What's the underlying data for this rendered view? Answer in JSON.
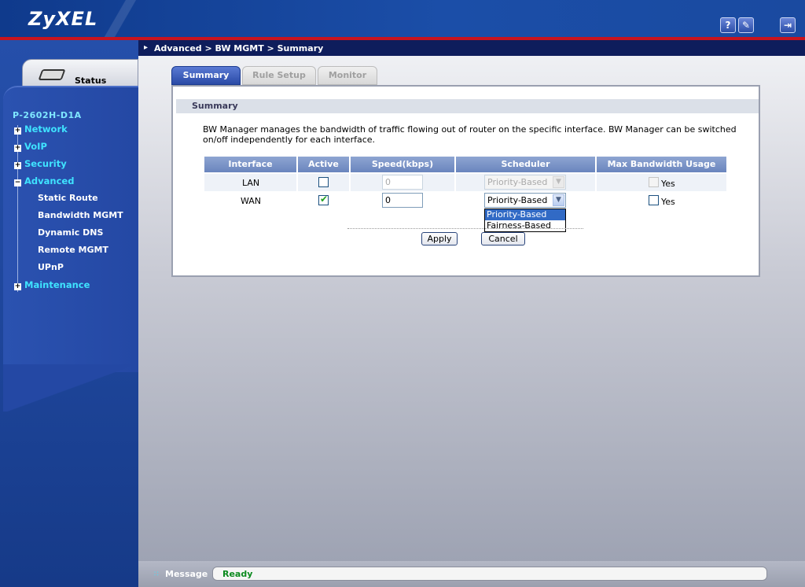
{
  "header": {
    "logo": "ZyXEL",
    "help_label": "?",
    "wizard_label": "✎",
    "logout_label": "⇥"
  },
  "sidebar": {
    "status_label": "Status",
    "model": "P-2602H-D1A",
    "menus": [
      {
        "label": "Network",
        "toggle": "+"
      },
      {
        "label": "VoIP",
        "toggle": "+"
      },
      {
        "label": "Security",
        "toggle": "+"
      },
      {
        "label": "Advanced",
        "toggle": "−"
      },
      {
        "label": "Maintenance",
        "toggle": "+"
      }
    ],
    "advanced_items": [
      "Static Route",
      "Bandwidth MGMT",
      "Dynamic DNS",
      "Remote MGMT",
      "UPnP"
    ]
  },
  "breadcrumb": "Advanced > BW MGMT > Summary",
  "tabs": [
    {
      "label": "Summary",
      "active": true
    },
    {
      "label": "Rule Setup",
      "active": false
    },
    {
      "label": "Monitor",
      "active": false
    }
  ],
  "section_title": "Summary",
  "description": "BW Manager manages the bandwidth of traffic flowing out of router on the specific interface. BW Manager can be switched on/off independently for each interface.",
  "table": {
    "headers": [
      "Interface",
      "Active",
      "Speed(kbps)",
      "Scheduler",
      "Max Bandwidth Usage"
    ],
    "rows": [
      {
        "interface": "LAN",
        "active": false,
        "speed": "0",
        "scheduler": "Priority-Based",
        "max_usage_label": "Yes",
        "enabled": false
      },
      {
        "interface": "WAN",
        "active": true,
        "speed": "0",
        "scheduler": "Priority-Based",
        "max_usage_label": "Yes",
        "enabled": true
      }
    ]
  },
  "scheduler_options": [
    "Priority-Based",
    "Fairness-Based"
  ],
  "buttons": {
    "apply": "Apply",
    "cancel": "Cancel"
  },
  "statusbar": {
    "label": "Message",
    "message": "Ready"
  },
  "colors": {
    "accent_red": "#c8141e",
    "header_blue": "#1b4ea8",
    "menu_cyan": "#3fe3ff",
    "ready_green": "#0b8a1e"
  }
}
